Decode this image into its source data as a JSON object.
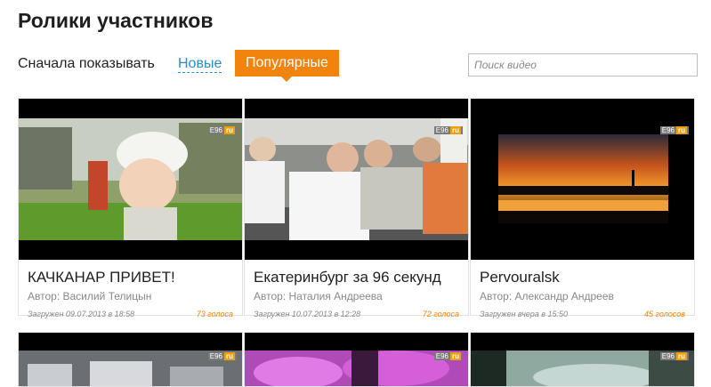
{
  "page_title": "Ролики участников",
  "sort": {
    "label": "Сначала показывать",
    "tabs": [
      {
        "label": "Новые",
        "active": false
      },
      {
        "label": "Популярные",
        "active": true
      }
    ]
  },
  "search": {
    "placeholder": "Поиск видео",
    "value": ""
  },
  "colors": {
    "accent": "#f0840c",
    "link": "#2a8fbd"
  },
  "badge": {
    "text": "E96",
    "mark": "ru"
  },
  "videos": [
    {
      "title": "КАЧКАНАР ПРИВЕТ!",
      "author": "Автор: Василий Телицын",
      "uploaded": "Загружен 09.07.2013 в 18:58",
      "votes": "73 голоса"
    },
    {
      "title": "Екатеринбург за 96 секунд",
      "author": "Автор: Наталия Андреева",
      "uploaded": "Загружен 10.07.2013 в 12:28",
      "votes": "72 голоса"
    },
    {
      "title": "Pervouralsk",
      "author": "Автор: Александр Андреев",
      "uploaded": "Загружен вчера в 15:50",
      "votes": "45 голосов"
    }
  ]
}
